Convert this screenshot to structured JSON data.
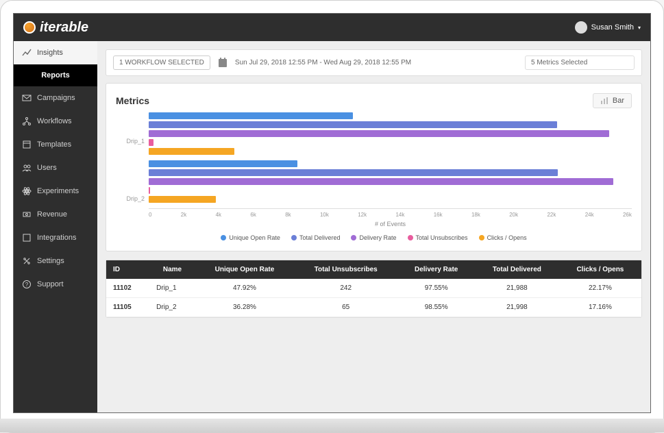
{
  "brand": "iterable",
  "user": {
    "name": "Susan Smith"
  },
  "sidebar": {
    "items": [
      {
        "label": "Insights",
        "icon": "insights-icon"
      },
      {
        "label": "Reports",
        "icon": ""
      },
      {
        "label": "Campaigns",
        "icon": "campaigns-icon"
      },
      {
        "label": "Workflows",
        "icon": "workflows-icon"
      },
      {
        "label": "Templates",
        "icon": "templates-icon"
      },
      {
        "label": "Users",
        "icon": "users-icon"
      },
      {
        "label": "Experiments",
        "icon": "experiments-icon"
      },
      {
        "label": "Revenue",
        "icon": "revenue-icon"
      },
      {
        "label": "Integrations",
        "icon": "integrations-icon"
      },
      {
        "label": "Settings",
        "icon": "settings-icon"
      },
      {
        "label": "Support",
        "icon": "support-icon"
      }
    ]
  },
  "filters": {
    "workflow_pill": "1 WORKFLOW SELECTED",
    "date_range": "Sun Jul 29, 2018 12:55 PM - Wed Aug 29, 2018 12:55 PM",
    "metrics_pill": "5 Metrics Selected"
  },
  "metrics_card": {
    "title": "Metrics",
    "chart_type_button": "Bar"
  },
  "chart_data": {
    "type": "bar",
    "orientation": "horizontal",
    "categories": [
      "Drip_1",
      "Drip_2"
    ],
    "series": [
      {
        "name": "Unique Open Rate",
        "color": "#4A90E2",
        "values": [
          11000,
          8000
        ]
      },
      {
        "name": "Total Delivered",
        "color": "#6B7FD7",
        "values": [
          21988,
          21998
        ]
      },
      {
        "name": "Delivery Rate",
        "color": "#A06CD5",
        "values": [
          24800,
          25000
        ]
      },
      {
        "name": "Total Unsubscribes",
        "color": "#E85D9E",
        "values": [
          242,
          65
        ]
      },
      {
        "name": "Clicks / Opens",
        "color": "#F5A623",
        "values": [
          4600,
          3600
        ]
      }
    ],
    "xlabel": "# of Events",
    "xlim": [
      0,
      26000
    ],
    "xticks": [
      "0",
      "2k",
      "4k",
      "6k",
      "8k",
      "10k",
      "12k",
      "14k",
      "16k",
      "18k",
      "20k",
      "22k",
      "24k",
      "26k"
    ]
  },
  "table": {
    "headers": [
      "ID",
      "Name",
      "Unique Open Rate",
      "Total Unsubscribes",
      "Delivery Rate",
      "Total Delivered",
      "Clicks / Opens"
    ],
    "rows": [
      {
        "id": "11102",
        "name": "Drip_1",
        "uor": "47.92%",
        "tu": "242",
        "dr": "97.55%",
        "td": "21,988",
        "co": "22.17%"
      },
      {
        "id": "11105",
        "name": "Drip_2",
        "uor": "36.28%",
        "tu": "65",
        "dr": "98.55%",
        "td": "21,998",
        "co": "17.16%"
      }
    ]
  }
}
